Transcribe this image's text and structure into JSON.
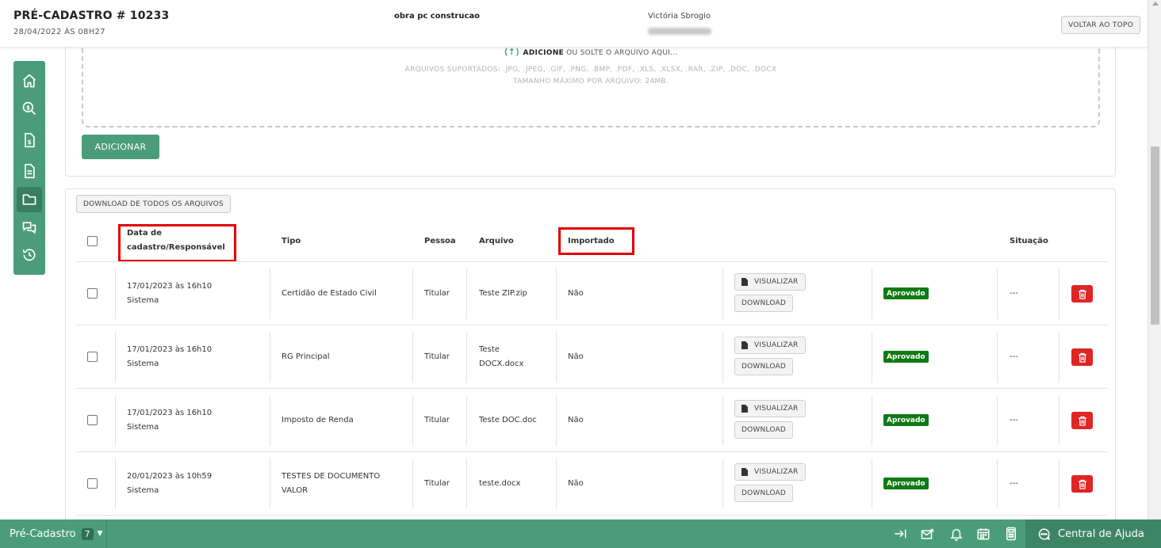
{
  "header": {
    "title": "PRÉ-CADASTRO # 10233",
    "date": "28/04/2022 ÀS 08H27",
    "obra": "obra pc construcao",
    "user": "Victória Sbrogio",
    "back_to_top_label": "VOLTAR AO TOPO"
  },
  "sidebar": {
    "items": [
      {
        "icon": "home-icon"
      },
      {
        "icon": "search-money-icon"
      },
      {
        "icon": "invoice-icon"
      },
      {
        "icon": "document-icon"
      },
      {
        "icon": "folder-icon",
        "active": true
      },
      {
        "icon": "chat-icon"
      },
      {
        "icon": "history-icon"
      }
    ]
  },
  "upload": {
    "add_text": "ADICIONE",
    "drop_text": "OU SOLTE O ARQUIVO AQUI...",
    "supported": "ARQUIVOS SUPORTADOS: .JPG, .JPEG, .GIF, .PNG, .BMP, .PDF, .XLS, .XLSX, .RAR, .ZIP, .DOC, .DOCX",
    "max_size": "TAMANHO MÁXIMO POR ARQUIVO: 24MB.",
    "add_button": "ADICIONAR"
  },
  "files": {
    "download_all": "DOWNLOAD DE TODOS OS ARQUIVOS",
    "headers": {
      "date_line1": "Data de",
      "date_line2": "cadastro/Responsável",
      "tipo": "Tipo",
      "pessoa": "Pessoa",
      "arquivo": "Arquivo",
      "importado": "Importado",
      "situacao": "Situação"
    },
    "view_label": "VISUALIZAR",
    "download_label": "DOWNLOAD",
    "rows": [
      {
        "date": "17/01/2023 às 16h10",
        "resp": "Sistema",
        "tipo_1": "Certidão de Estado Civil",
        "tipo_2": "",
        "pessoa": "Titular",
        "arquivo_1": "Teste ZIP.zip",
        "arquivo_2": "",
        "importado": "Não",
        "status": "Aprovado",
        "situacao": "---"
      },
      {
        "date": "17/01/2023 às 16h10",
        "resp": "Sistema",
        "tipo_1": "RG Principal",
        "tipo_2": "",
        "pessoa": "Titular",
        "arquivo_1": "Teste",
        "arquivo_2": "DOCX.docx",
        "importado": "Não",
        "status": "Aprovado",
        "situacao": "---"
      },
      {
        "date": "17/01/2023 às 16h10",
        "resp": "Sistema",
        "tipo_1": "Imposto de Renda",
        "tipo_2": "",
        "pessoa": "Titular",
        "arquivo_1": "Teste DOC.doc",
        "arquivo_2": "",
        "importado": "Não",
        "status": "Aprovado",
        "situacao": "---"
      },
      {
        "date": "20/01/2023 às 10h59",
        "resp": "Sistema",
        "tipo_1": "TESTES DE DOCUMENTO",
        "tipo_2": "VALOR",
        "pessoa": "Titular",
        "arquivo_1": "teste.docx",
        "arquivo_2": "",
        "importado": "Não",
        "status": "Aprovado",
        "situacao": "---"
      }
    ]
  },
  "bottombar": {
    "label": "Pré-Cadastro",
    "count": "7",
    "help": "Central de Ajuda",
    "icons": [
      "arrow-to-right-icon",
      "mail-star-icon",
      "bell-icon",
      "calendar-icon",
      "calculator-icon"
    ]
  },
  "colors": {
    "brand_green": "#4a9d78",
    "approved_green": "#0f7a12",
    "delete_red": "#e02525",
    "highlight_red": "#e00000"
  }
}
